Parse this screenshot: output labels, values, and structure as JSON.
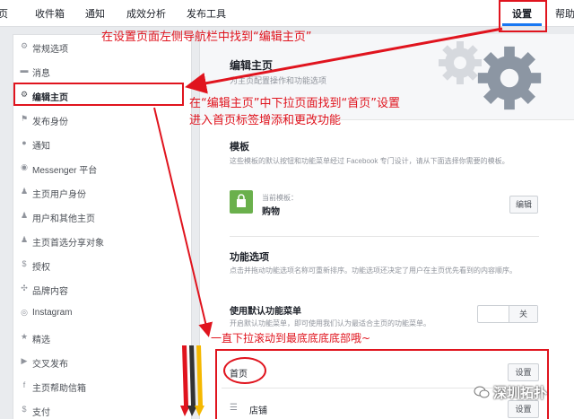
{
  "topnav": {
    "tabs": [
      {
        "label": "页"
      },
      {
        "label": "收件箱"
      },
      {
        "label": "通知"
      },
      {
        "label": "成效分析"
      },
      {
        "label": "发布工具"
      },
      {
        "label": "设置"
      },
      {
        "label": "帮助"
      }
    ]
  },
  "sidebar": {
    "items": [
      {
        "label": "常规选项",
        "icon": "gear-icon"
      },
      {
        "label": "消息",
        "icon": "message-icon"
      },
      {
        "label": "编辑主页",
        "icon": "gear-icon"
      },
      {
        "label": "发布身份",
        "icon": "flag-icon"
      },
      {
        "label": "通知",
        "icon": "globe-icon"
      },
      {
        "label": "Messenger 平台",
        "icon": "chat-icon"
      },
      {
        "label": "主页用户身份",
        "icon": "person-icon"
      },
      {
        "label": "用户和其他主页",
        "icon": "people-icon"
      },
      {
        "label": "主页首选分享对象",
        "icon": "people-icon"
      },
      {
        "label": "授权",
        "icon": "dollar-icon"
      },
      {
        "label": "品牌内容",
        "icon": "brand-icon"
      },
      {
        "label": "Instagram",
        "icon": "instagram-icon"
      },
      {
        "label": "精选",
        "icon": "star-icon"
      },
      {
        "label": "交叉发布",
        "icon": "video-icon"
      },
      {
        "label": "主页帮助信箱",
        "icon": "facebook-icon"
      },
      {
        "label": "支付",
        "icon": "dollar-icon"
      }
    ]
  },
  "main": {
    "title": "编辑主页",
    "subtitle": "为主页配置操作和功能选项",
    "template": {
      "heading": "模板",
      "desc": "这些模板的默认按钮和功能菜单经过 Facebook 专门设计，请从下面选择你需要的模板。",
      "current_label": "当前模板：",
      "current_value": "购物",
      "edit_label": "编辑"
    },
    "features": {
      "heading": "功能选项",
      "desc": "点击并拖动功能选项名称可重新排序。功能选项还决定了用户在主页优先看到的内容顺序。",
      "default_menu_label": "使用默认功能菜单",
      "default_menu_desc": "开启默认功能菜单，即可使用我们认为最适合主页的功能菜单。",
      "toggle_off": "关"
    },
    "tabs_list": [
      {
        "label": "首页",
        "button": "设置"
      },
      {
        "label": "店铺",
        "button": "设置"
      }
    ]
  },
  "annotations": {
    "a1": "在设置页面左侧导航栏中找到“编辑主页”",
    "a2_line1": "在“编辑主页”中下拉页面找到“首页”设置",
    "a2_line2": "进入首页标签增添和更改功能",
    "a3": "一直下拉滚动到最底底底底部哦~"
  },
  "watermark": "深圳拓扑",
  "colors": {
    "accent": "#1877f2",
    "annotation": "#e0141e"
  }
}
